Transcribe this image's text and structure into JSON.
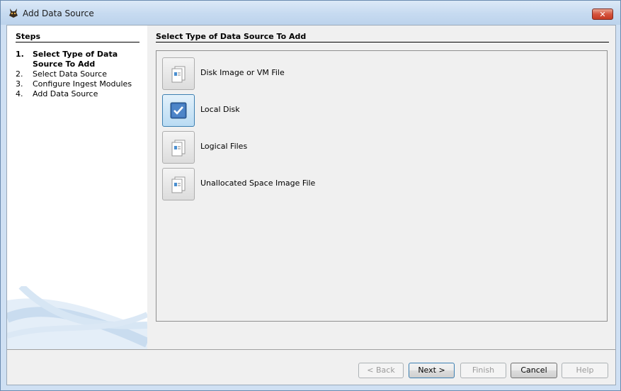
{
  "window": {
    "title": "Add Data Source",
    "close_symbol": "✕"
  },
  "steps": {
    "heading": "Steps",
    "items": [
      {
        "num": "1.",
        "label_line1": "Select Type of Data",
        "label_line2": "Source To Add",
        "active": true
      },
      {
        "num": "2.",
        "label": "Select Data Source"
      },
      {
        "num": "3.",
        "label": "Configure Ingest Modules"
      },
      {
        "num": "4.",
        "label": "Add Data Source"
      }
    ]
  },
  "main": {
    "heading": "Select Type of Data Source To Add",
    "data_sources": [
      {
        "label": "Disk Image or VM File",
        "selected": false,
        "icon": "disk-image-icon"
      },
      {
        "label": "Local Disk",
        "selected": true,
        "icon": "checkbox-checked-icon"
      },
      {
        "label": "Logical Files",
        "selected": false,
        "icon": "logical-files-icon"
      },
      {
        "label": "Unallocated Space Image File",
        "selected": false,
        "icon": "unallocated-space-icon"
      }
    ]
  },
  "buttons": {
    "back": "< Back",
    "next": "Next >",
    "finish": "Finish",
    "cancel": "Cancel",
    "help": "Help"
  },
  "colors": {
    "accent": "#3c7fb1",
    "selected_tile": "#b9dbf3"
  }
}
